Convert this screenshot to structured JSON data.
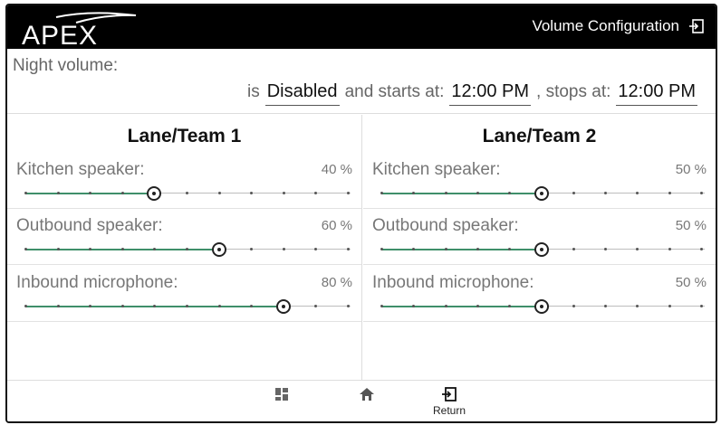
{
  "header": {
    "logo_text": "APEX",
    "title": "Volume Configuration"
  },
  "night_volume": {
    "label": "Night volume:",
    "is_label": "is",
    "status": "Disabled",
    "starts_label": "and starts at:",
    "start_time": "12:00 PM",
    "stops_label": ", stops at:",
    "stop_time": "12:00 PM"
  },
  "teams": [
    {
      "name": "Lane/Team 1",
      "controls": [
        {
          "label": "Kitchen speaker:",
          "value_text": "40 %",
          "value": 40
        },
        {
          "label": "Outbound speaker:",
          "value_text": "60 %",
          "value": 60
        },
        {
          "label": "Inbound microphone:",
          "value_text": "80 %",
          "value": 80
        }
      ]
    },
    {
      "name": "Lane/Team 2",
      "controls": [
        {
          "label": "Kitchen speaker:",
          "value_text": "50 %",
          "value": 50
        },
        {
          "label": "Outbound speaker:",
          "value_text": "50 %",
          "value": 50
        },
        {
          "label": "Inbound microphone:",
          "value_text": "50 %",
          "value": 50
        }
      ]
    }
  ],
  "bottom_nav": {
    "return_label": "Return"
  },
  "colors": {
    "header_bg": "#000000",
    "slider_fill": "#3f8f6a"
  }
}
